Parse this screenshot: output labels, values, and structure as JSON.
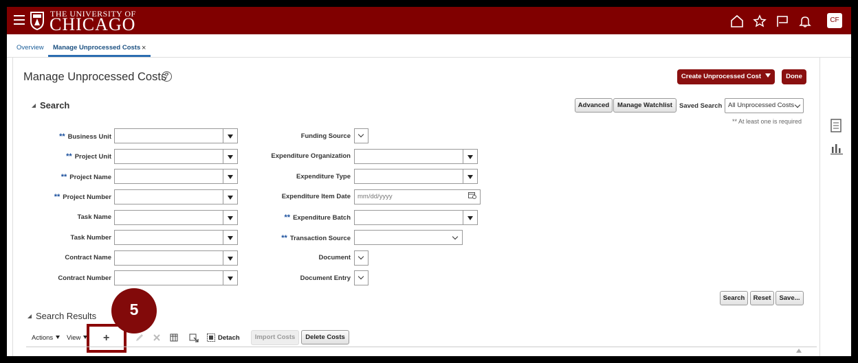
{
  "header": {
    "brand_line1": "THE UNIVERSITY OF",
    "brand_line2": "CHICAGO",
    "avatar_initials": "CF",
    "bar_color": "#800000",
    "icons": [
      "menu-icon",
      "home-icon",
      "star-icon",
      "flag-icon",
      "bell-icon"
    ]
  },
  "tabs": [
    {
      "label": "Overview"
    },
    {
      "label": "Manage Unprocessed Costs",
      "close": "×"
    }
  ],
  "page": {
    "title": "Manage Unprocessed Costs",
    "help": "?",
    "create_button": "Create Unprocessed Cost",
    "done_button": "Done"
  },
  "search": {
    "title": "Search",
    "advanced_button": "Advanced",
    "watchlist_button": "Manage Watchlist",
    "saved_search_label": "Saved Search",
    "saved_search_value": "All Unprocessed Costs",
    "required_note": "** At least one is required",
    "required_marker": "**",
    "left_fields": [
      {
        "label": "Business Unit",
        "required": true
      },
      {
        "label": "Project Unit",
        "required": true
      },
      {
        "label": "Project Name",
        "required": true
      },
      {
        "label": "Project Number",
        "required": true
      },
      {
        "label": "Task Name",
        "required": false
      },
      {
        "label": "Task Number",
        "required": false
      },
      {
        "label": "Contract Name",
        "required": false
      },
      {
        "label": "Contract Number",
        "required": false
      }
    ],
    "right_fields": [
      {
        "label": "Funding Source"
      },
      {
        "label": "Expenditure Organization"
      },
      {
        "label": "Expenditure Type"
      },
      {
        "label": "Expenditure Item Date",
        "placeholder": "mm/dd/yyyy"
      },
      {
        "label": "Expenditure Batch",
        "required": true
      },
      {
        "label": "Transaction Source",
        "required": true
      },
      {
        "label": "Document"
      },
      {
        "label": "Document Entry"
      }
    ],
    "search_button": "Search",
    "reset_button": "Reset",
    "save_button": "Save..."
  },
  "results": {
    "title": "Search Results",
    "actions_menu": "Actions",
    "view_menu": "View",
    "add_icon": "+",
    "detach": "Detach",
    "import_button": "Import Costs",
    "delete_button": "Delete Costs"
  },
  "callout": {
    "step_number": "5",
    "color": "#820a0a"
  }
}
